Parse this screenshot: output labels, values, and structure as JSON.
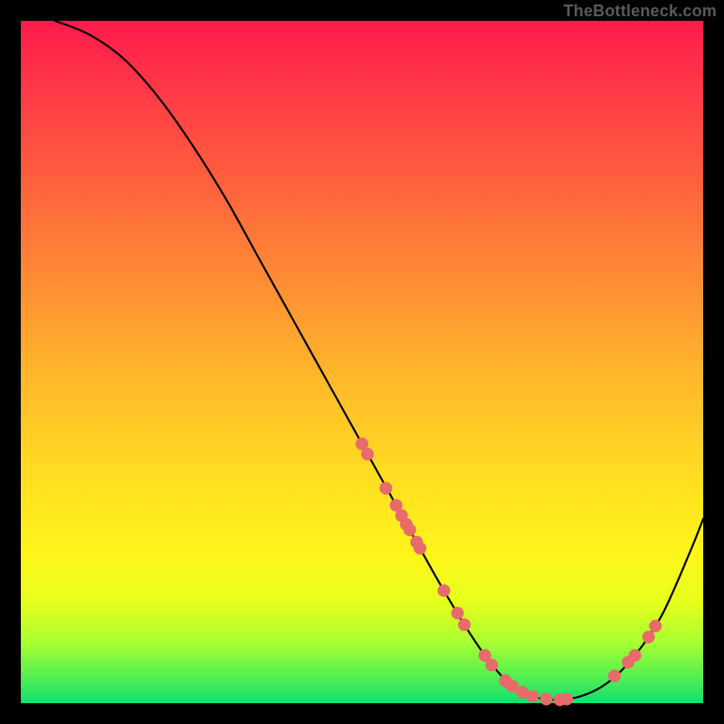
{
  "watermark": "TheBottleneck.com",
  "chart_data": {
    "type": "line",
    "title": "",
    "xlabel": "",
    "ylabel": "",
    "xlim": [
      0,
      100
    ],
    "ylim": [
      0,
      100
    ],
    "grid": false,
    "series": [
      {
        "name": "curve",
        "x": [
          5,
          10,
          15,
          20,
          25,
          30,
          35,
          40,
          45,
          50,
          55,
          60,
          62,
          65,
          68,
          70,
          72,
          75,
          78,
          82,
          86,
          90,
          94,
          98,
          100
        ],
        "y": [
          100,
          98,
          94.5,
          89,
          82,
          74,
          65,
          56,
          47,
          38,
          29,
          20,
          16.5,
          11.5,
          7,
          4.5,
          2.5,
          1,
          0.5,
          1,
          3,
          7,
          13,
          22,
          27
        ]
      }
    ],
    "markers": [
      {
        "x": 50.0,
        "y": 38.0
      },
      {
        "x": 50.8,
        "y": 36.5
      },
      {
        "x": 53.5,
        "y": 31.5
      },
      {
        "x": 55.0,
        "y": 29.0
      },
      {
        "x": 55.8,
        "y": 27.5
      },
      {
        "x": 56.5,
        "y": 26.2
      },
      {
        "x": 57.0,
        "y": 25.4
      },
      {
        "x": 58.0,
        "y": 23.6
      },
      {
        "x": 58.5,
        "y": 22.7
      },
      {
        "x": 62.0,
        "y": 16.5
      },
      {
        "x": 64.0,
        "y": 13.2
      },
      {
        "x": 65.0,
        "y": 11.5
      },
      {
        "x": 68.0,
        "y": 7.0
      },
      {
        "x": 69.0,
        "y": 5.6
      },
      {
        "x": 71.0,
        "y": 3.3
      },
      {
        "x": 72.0,
        "y": 2.5
      },
      {
        "x": 73.5,
        "y": 1.6
      },
      {
        "x": 75.0,
        "y": 1.0
      },
      {
        "x": 77.0,
        "y": 0.6
      },
      {
        "x": 79.0,
        "y": 0.5
      },
      {
        "x": 80.0,
        "y": 0.6
      },
      {
        "x": 87.0,
        "y": 4.0
      },
      {
        "x": 89.0,
        "y": 6.0
      },
      {
        "x": 90.0,
        "y": 7.0
      },
      {
        "x": 92.0,
        "y": 9.7
      },
      {
        "x": 93.0,
        "y": 11.3
      }
    ],
    "marker_style": {
      "color": "#e86a6a",
      "radius_px": 7
    }
  }
}
